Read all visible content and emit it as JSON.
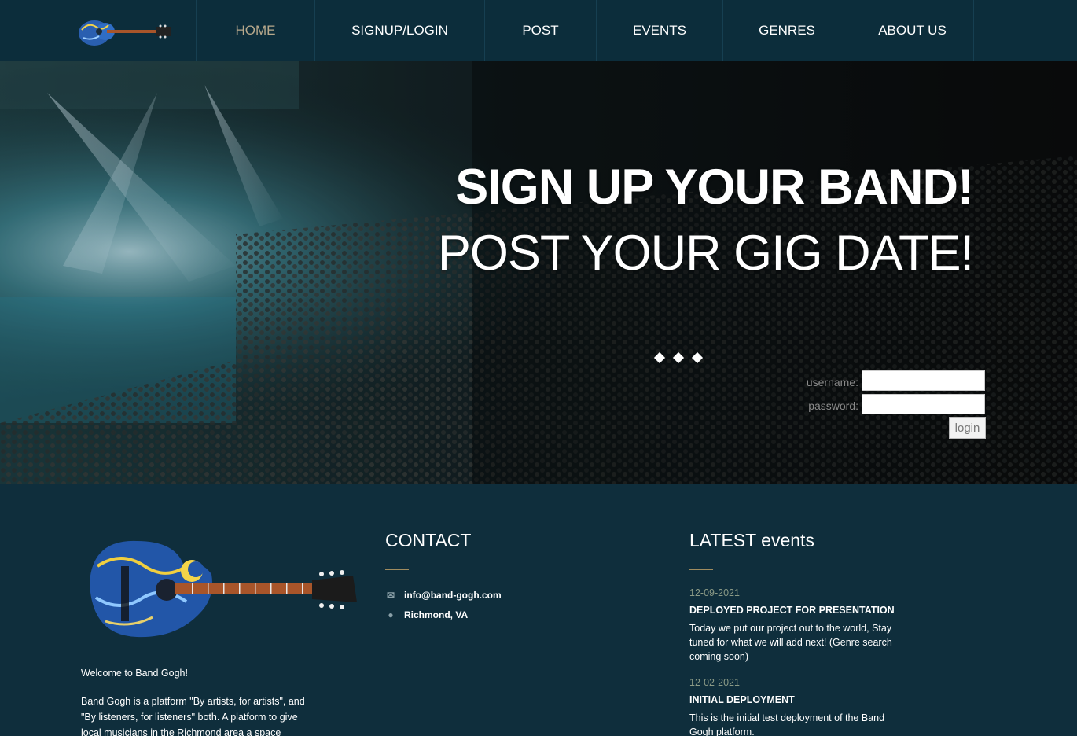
{
  "nav": {
    "items": [
      {
        "label": "HOME",
        "active": true
      },
      {
        "label": "SIGNUP/LOGIN",
        "active": false
      },
      {
        "label": "POST",
        "active": false
      },
      {
        "label": "EVENTS",
        "active": false
      },
      {
        "label": "GENRES",
        "active": false
      },
      {
        "label": "ABOUT US",
        "active": false
      }
    ]
  },
  "hero": {
    "headline": "SIGN UP YOUR BAND!",
    "subline": "POST YOUR GIG DATE!",
    "login": {
      "username_label": "username:",
      "password_label": "password:",
      "username_value": "",
      "password_value": "",
      "button_label": "login"
    }
  },
  "footer": {
    "welcome": "Welcome to Band Gogh!",
    "about": "Band Gogh is a platform \"By artists, for artists\", and \"By listeners, for listeners\" both. A platform to give local musicians in the Richmond area a space",
    "contact": {
      "title": "CONTACT",
      "email": "info@band-gogh.com",
      "location": "Richmond, VA"
    },
    "events": {
      "title": "LATEST events",
      "items": [
        {
          "date": "12-09-2021",
          "title": "DEPLOYED PROJECT FOR PRESENTATION",
          "desc": "Today we put our project out to the world, Stay tuned for what we will add next! (Genre search coming soon)"
        },
        {
          "date": "12-02-2021",
          "title": "INITIAL DEPLOYMENT",
          "desc": "This is the initial test deployment of the Band Gogh platform."
        }
      ]
    }
  },
  "colors": {
    "nav_bg": "#0c2d3b",
    "footer_bg": "#0f2e3c",
    "active_nav": "#b8a98c",
    "accent_underline": "#a08c5f"
  },
  "icons": {
    "email": "envelope-icon",
    "location": "map-marker-icon",
    "logo": "starry-night-guitar-logo"
  }
}
